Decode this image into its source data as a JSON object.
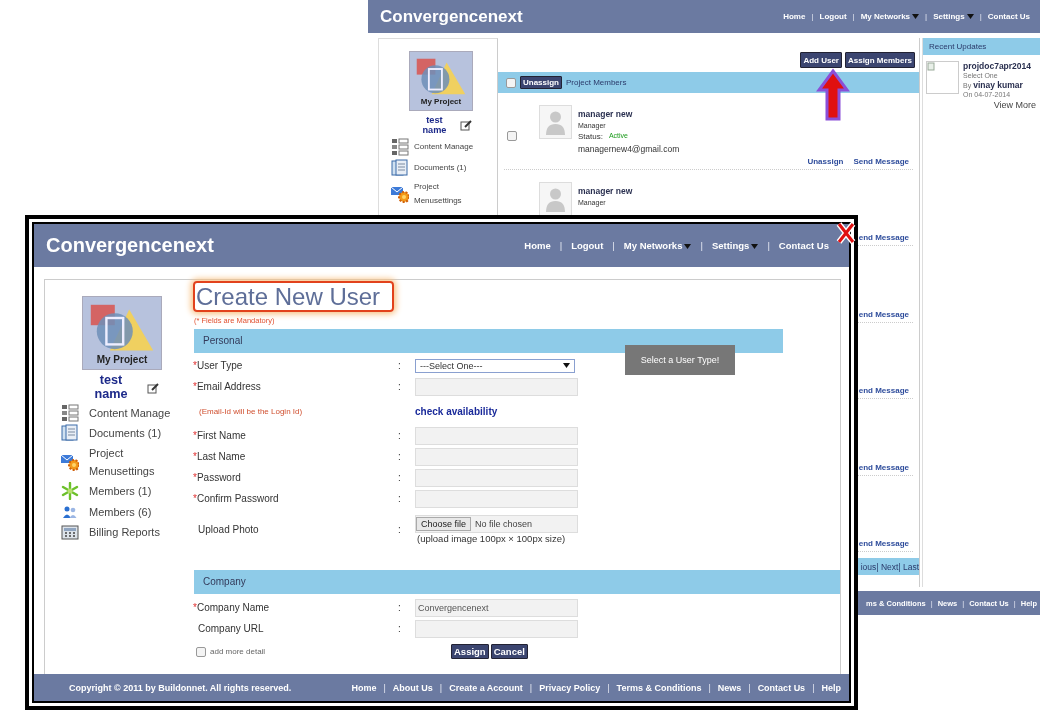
{
  "background_page": {
    "header": {
      "logo": "Convergencenext",
      "nav": [
        {
          "text": "Home",
          "kind": "link"
        },
        {
          "text": "|",
          "kind": "separator"
        },
        {
          "text": "Logout",
          "kind": "link"
        },
        {
          "text": "|",
          "kind": "separator"
        },
        {
          "text": "My Networks",
          "kind": "link",
          "dropdown": true
        },
        {
          "text": "|",
          "kind": "separator"
        },
        {
          "text": "Settings",
          "kind": "link",
          "dropdown": true
        },
        {
          "text": "|",
          "kind": "separator"
        },
        {
          "text": "Contact Us",
          "kind": "link"
        }
      ]
    },
    "sidebar": {
      "project": "My Project",
      "user": "test name",
      "items": [
        "Content Manage",
        "Documents (1)",
        "Project Menusettings"
      ]
    },
    "toolbar": [
      "Add User",
      "Assign Members"
    ],
    "members_bar": {
      "checked": false,
      "button": "Unassign",
      "title": "Project Members"
    },
    "members": [
      {
        "checked": false,
        "name": "manager new",
        "role": "Manager",
        "status_label": "Status:",
        "status": "Active",
        "email": "managernew4@gmail.com",
        "links": [
          "Unassign",
          "Send Message"
        ]
      },
      {
        "name": "manager new",
        "role": "Manager",
        "links": [
          "end Message"
        ]
      },
      {
        "links": [
          "end Message"
        ]
      },
      {
        "links": [
          "end Message"
        ]
      },
      {
        "links": [
          "end Message"
        ]
      },
      {
        "links": [
          "end Message"
        ]
      }
    ],
    "pager": "ious| Next| Last",
    "recent_updates": {
      "title": "Recent Updates",
      "items": [
        {
          "title": "projdoc7apr2014",
          "subtitle": "Select One",
          "by": "By",
          "author": "vinay kumar",
          "date": "On 04-07-2014"
        }
      ],
      "more": "View More"
    },
    "footer": [
      {
        "text": "ms & Conditions",
        "kind": "link"
      },
      {
        "text": "|",
        "kind": "separator"
      },
      {
        "text": "News",
        "kind": "link"
      },
      {
        "text": "|",
        "kind": "separator"
      },
      {
        "text": "Contact Us",
        "kind": "link"
      },
      {
        "text": "|",
        "kind": "separator"
      },
      {
        "text": "Help",
        "kind": "link"
      }
    ]
  },
  "popup": {
    "header": {
      "logo": "Convergencenext",
      "nav": [
        {
          "text": "Home",
          "kind": "link"
        },
        {
          "text": "|",
          "kind": "separator"
        },
        {
          "text": "Logout",
          "kind": "link"
        },
        {
          "text": "|",
          "kind": "separator"
        },
        {
          "text": "My Networks",
          "kind": "link",
          "dropdown": true
        },
        {
          "text": "|",
          "kind": "separator"
        },
        {
          "text": "Settings",
          "kind": "link",
          "dropdown": true
        },
        {
          "text": "|",
          "kind": "separator"
        },
        {
          "text": "Contact Us",
          "kind": "link"
        }
      ]
    },
    "sidebar": {
      "project": "My Project",
      "user": "test name",
      "items": [
        "Content Manage",
        "Documents (1)",
        "Project Menusettings",
        "Members (1)",
        "Members (6)",
        "Billing Reports"
      ]
    },
    "title": "Create New User",
    "mandatory_note": "(* Fields are Mandatory)",
    "sections": [
      {
        "title": "Personal",
        "fields": [
          {
            "kind": "select",
            "required_mark": "*",
            "label": "User Type",
            "colon": ":",
            "value": "---Select One---",
            "tooltip": "Select a User Type!"
          },
          {
            "kind": "text",
            "required_mark": "*",
            "label": "Email Address",
            "colon": ":"
          },
          {
            "kind": "note",
            "note": "(Email-Id will be the Login Id)",
            "link": "check availability"
          },
          {
            "kind": "text",
            "required_mark": "*",
            "label": "First Name",
            "colon": ":"
          },
          {
            "kind": "text",
            "required_mark": "*",
            "label": "Last Name",
            "colon": ":"
          },
          {
            "kind": "text",
            "required_mark": "*",
            "label": "Password",
            "colon": ":"
          },
          {
            "kind": "text",
            "required_mark": "*",
            "label": "Confirm Password",
            "colon": ":"
          },
          {
            "kind": "file",
            "label": "Upload Photo",
            "colon": ":",
            "button": "Choose file",
            "status": "No file chosen",
            "hint": "(upload image 100px × 100px size)"
          }
        ]
      },
      {
        "title": "Company",
        "fields": [
          {
            "kind": "text",
            "required_mark": "*",
            "label": "Company Name",
            "colon": ":",
            "value": "Convergencenext"
          },
          {
            "kind": "text",
            "label": "Company URL",
            "colon": ":"
          }
        ]
      }
    ],
    "more_detail": {
      "checked": false,
      "label": "add more detail"
    },
    "buttons": [
      "Assign",
      "Cancel"
    ],
    "footer": {
      "copyright": "Copyright © 2011 by Buildonnet. All rights reserved.",
      "links": [
        {
          "text": "Home",
          "kind": "link"
        },
        {
          "text": "|",
          "kind": "separator"
        },
        {
          "text": "About Us",
          "kind": "link"
        },
        {
          "text": "|",
          "kind": "separator"
        },
        {
          "text": "Create a Account",
          "kind": "link"
        },
        {
          "text": "|",
          "kind": "separator"
        },
        {
          "text": "Privacy Policy",
          "kind": "link"
        },
        {
          "text": "|",
          "kind": "separator"
        },
        {
          "text": "Terms & Conditions",
          "kind": "link"
        },
        {
          "text": "|",
          "kind": "separator"
        },
        {
          "text": "News",
          "kind": "link"
        },
        {
          "text": "|",
          "kind": "separator"
        },
        {
          "text": "Contact Us",
          "kind": "link"
        },
        {
          "text": "|",
          "kind": "separator"
        },
        {
          "text": "Help",
          "kind": "link"
        }
      ]
    }
  }
}
